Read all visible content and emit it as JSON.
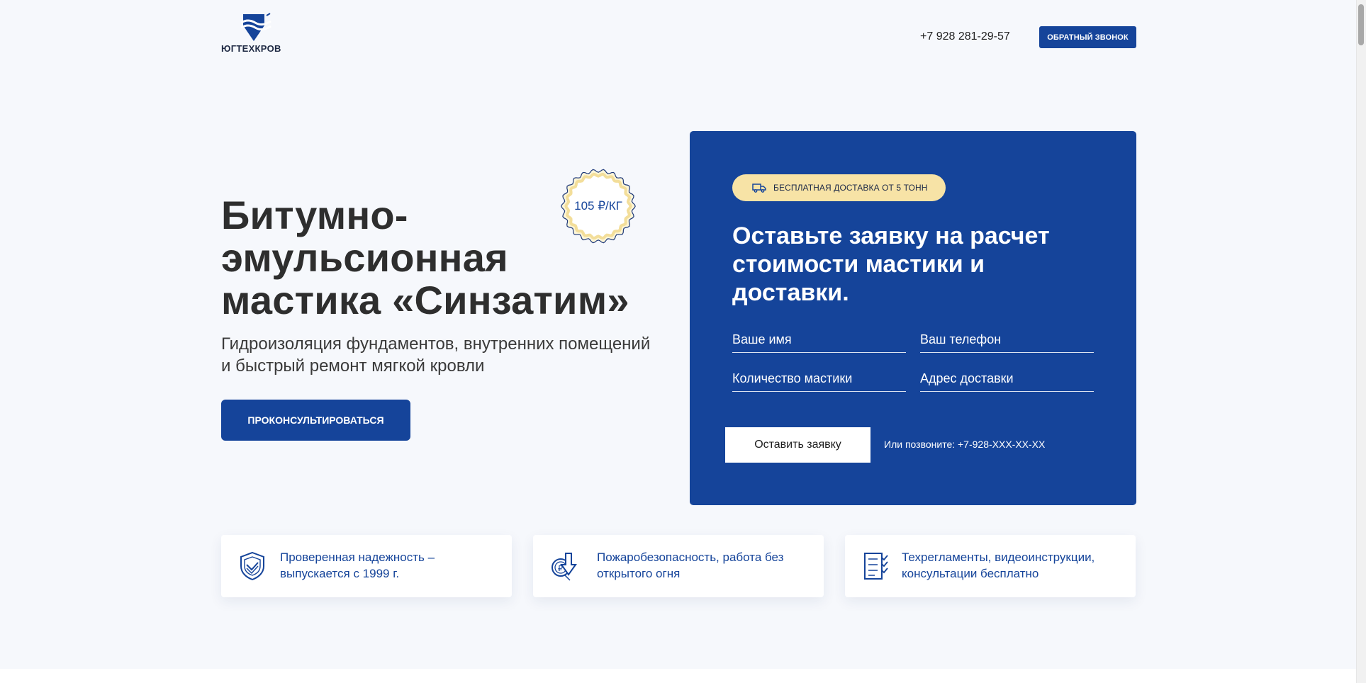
{
  "header": {
    "logo_text": "ЮГТЕХКРОВ",
    "phone": "+7 928 281-29-57",
    "callback_label": "ОБРАТНЫЙ ЗВОНОК"
  },
  "hero": {
    "title_line1": "Битумно-",
    "title_line2": "эмульсионная",
    "title_line3": "мастика «Синзатим»",
    "subtitle_line1": "Гидроизоляция фундаментов, внутренних помещений",
    "subtitle_line2": "и быстрый ремонт мягкой кровли",
    "consult_label": "ПРОКОНСУЛЬТИРОВАТЬСЯ",
    "price_badge": "105 ₽/КГ"
  },
  "form": {
    "delivery_badge": "БЕСПЛАТНАЯ ДОСТАВКА ОТ 5 ТОНН",
    "title": "Оставьте заявку на расчет стоимости мастики и доставки.",
    "name_placeholder": "Ваше имя",
    "phone_placeholder": "Ваш телефон",
    "quantity_placeholder": "Количество мастики",
    "address_placeholder": "Адрес доставки",
    "submit_label": "Оставить заявку",
    "or_call_text": "Или позвоните: +7-928-XXX-XX-XX"
  },
  "features": [
    {
      "icon": "shield-check-icon",
      "line1": "Проверенная надежность –",
      "line2": "выпускается с 1999 г."
    },
    {
      "icon": "fire-safe-coin-icon",
      "line1": "Пожаробезопасность, работа без",
      "line2": "открытого огня"
    },
    {
      "icon": "checklist-icon",
      "line1": "Техрегламенты, видеоинструкции,",
      "line2": "консультации бесплатно"
    }
  ],
  "colors": {
    "brand_blue": "#15449a",
    "badge_yellow": "#f7e3a6",
    "page_bg": "#f6f8fc"
  }
}
